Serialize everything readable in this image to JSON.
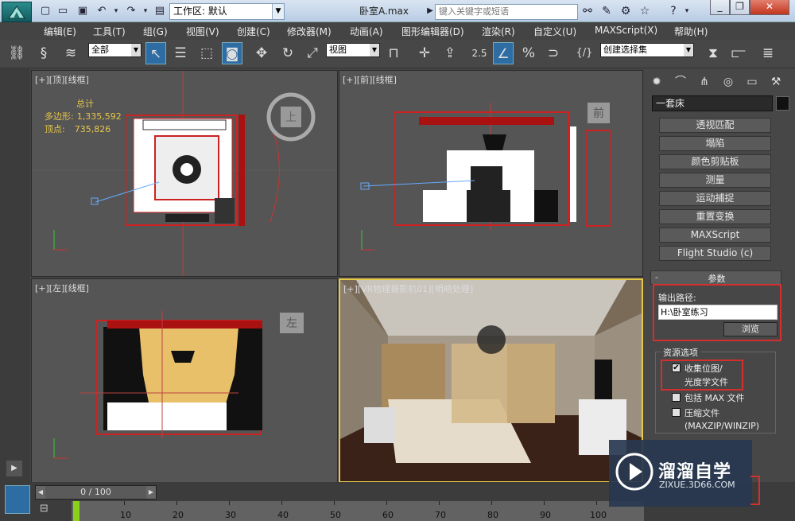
{
  "titlebar": {
    "workspace_label": "工作区: 默认",
    "doc_title": "卧室A.max",
    "search_placeholder": "键入关键字或短语"
  },
  "menus": [
    "编辑(E)",
    "工具(T)",
    "组(G)",
    "视图(V)",
    "创建(C)",
    "修改器(M)",
    "动画(A)",
    "图形编辑器(D)",
    "渲染(R)",
    "自定义(U)",
    "MAXScript(X)",
    "帮助(H)"
  ],
  "toolbar": {
    "selection_filter": "全部",
    "ref_coord": "视图",
    "snap_value": "2.5",
    "named_selection": "创建选择集"
  },
  "viewports": {
    "top": {
      "label": "[+][顶][线框]",
      "cube": "上"
    },
    "front": {
      "label": "[+][前][线框]",
      "cube": "前"
    },
    "left": {
      "label": "[+][左][线框]",
      "cube": "左"
    },
    "persp": {
      "label": "[+][VR物理摄影机01][明暗处理]"
    }
  },
  "stats": {
    "title": "总计",
    "poly_label": "多边形:",
    "poly_value": "1,335,592",
    "vert_label": "顶点:",
    "vert_value": "735,826"
  },
  "cmdpanel": {
    "object_name": "一套床",
    "utility_buttons": [
      "透视匹配",
      "塌陷",
      "颜色剪贴板",
      "测量",
      "运动捕捉",
      "重置变换",
      "MAXScript",
      "Flight Studio (c)"
    ],
    "params_sign": "-",
    "params_title": "参数",
    "output_path_label": "输出路径:",
    "output_path_value": "H:\\卧室练习",
    "browse_label": "浏览",
    "resource_group_title": "资源选项",
    "collect_bitmaps_line1": "收集位图/",
    "collect_bitmaps_line2": "光度学文件",
    "include_max_label": "包括 MAX 文件",
    "compress_label": "压缩文件",
    "compress_sub": "(MAXZIP/WINZIP)"
  },
  "timeslider": {
    "value": "0 / 100"
  },
  "timeline_labels": [
    "10",
    "20",
    "30",
    "40",
    "50",
    "60",
    "70",
    "80",
    "90",
    "100"
  ],
  "watermark": {
    "title": "溜溜自学",
    "url": "ZIXUE.3D66.COM"
  },
  "colors": {
    "accent_blue": "#2d6da3",
    "highlight_red": "#d32f2f",
    "active_viewport": "#e7c847",
    "stats_yellow": "#e8c64a"
  }
}
